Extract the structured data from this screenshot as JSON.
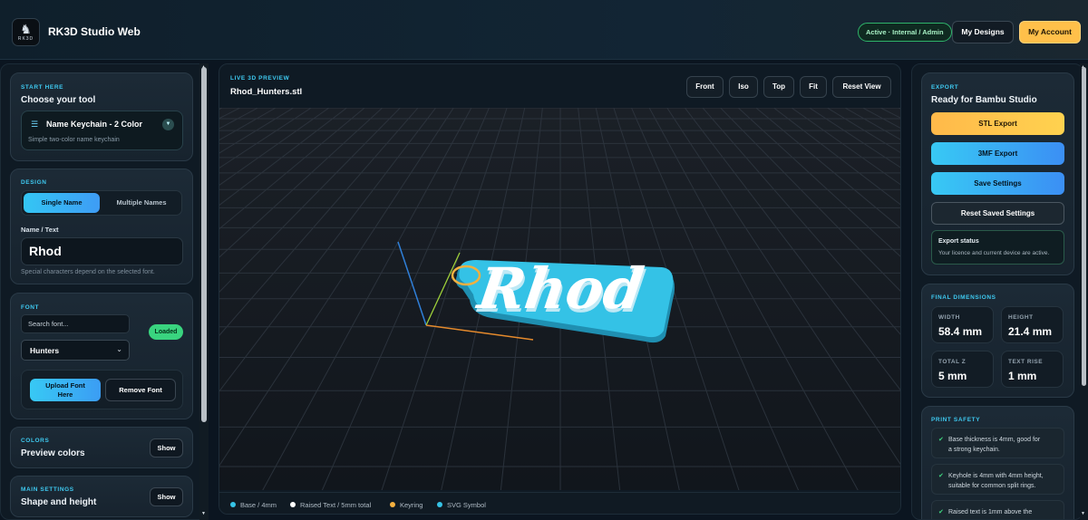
{
  "header": {
    "logo_text": "RK3D",
    "app_title": "RK3D Studio Web",
    "active_badge": "Active · Internal / Admin",
    "my_designs": "My Designs",
    "my_account": "My Account"
  },
  "left": {
    "start": {
      "label": "START HERE",
      "title": "Choose your tool",
      "tool_name": "Name Keychain - 2 Color",
      "tool_desc": "Simple two-color name keychain"
    },
    "design": {
      "label": "DESIGN",
      "tab_single": "Single Name",
      "tab_multiple": "Multiple Names",
      "name_label": "Name / Text",
      "name_value": "Rhod",
      "hint": "Special characters depend on the selected font."
    },
    "font": {
      "label": "FONT",
      "search_placeholder": "Search font...",
      "loaded_badge": "Loaded",
      "selected_font": "Hunters",
      "upload_line1": "Upload Font",
      "upload_line2": "Here",
      "remove_font": "Remove Font"
    },
    "colors": {
      "label": "COLORS",
      "title": "Preview colors",
      "show": "Show"
    },
    "main_settings": {
      "label": "MAIN SETTINGS",
      "title": "Shape and height",
      "show": "Show"
    }
  },
  "preview": {
    "label": "LIVE 3D PREVIEW",
    "filename": "Rhod_Hunters.stl",
    "buttons": [
      "Front",
      "Iso",
      "Top",
      "Fit",
      "Reset View"
    ],
    "model_text": "Rhod",
    "legend": [
      {
        "label": "Base / 4mm",
        "color": "#36c3e6"
      },
      {
        "label": "Raised Text / 5mm total",
        "color": "#ffffff"
      },
      {
        "label": "Keyring",
        "color": "#f4b03f"
      },
      {
        "label": "SVG Symbol",
        "color": "#36c3e6"
      }
    ]
  },
  "right": {
    "export": {
      "label": "EXPORT",
      "title": "Ready for Bambu Studio",
      "stl": "STL Export",
      "mf3": "3MF Export",
      "save": "Save Settings",
      "reset": "Reset Saved Settings",
      "status_title": "Export status",
      "status_desc": "Your licence and current device are active."
    },
    "dimensions": {
      "label": "FINAL DIMENSIONS",
      "items": [
        {
          "label": "WIDTH",
          "value": "58.4 mm"
        },
        {
          "label": "HEIGHT",
          "value": "21.4 mm"
        },
        {
          "label": "TOTAL Z",
          "value": "5 mm"
        },
        {
          "label": "TEXT RISE",
          "value": "1 mm"
        }
      ]
    },
    "safety": {
      "label": "PRINT SAFETY",
      "items": [
        {
          "line1": "Base thickness is 4mm, good for",
          "line2": "a strong keychain."
        },
        {
          "line1": "Keyhole is 4mm with 4mm height,",
          "line2": "suitable for common split rings."
        },
        {
          "line1": "Raised text is 1mm above the",
          "line2": ""
        }
      ]
    }
  },
  "colors": {
    "accent_cyan": "#3ec9f0",
    "accent_gold": "#ffc04a",
    "success_green": "#39d47f"
  }
}
